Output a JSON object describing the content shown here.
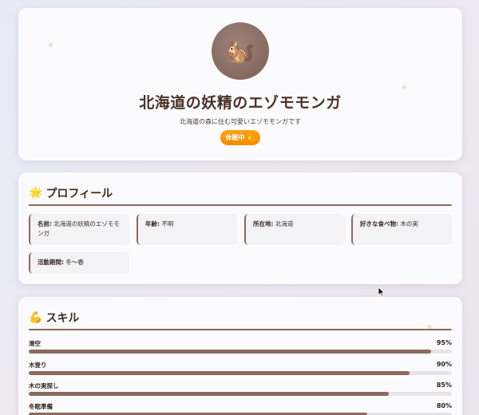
{
  "hero": {
    "avatar_emoji": "🐿️",
    "title": "北海道の妖精のエゾモモンガ",
    "subtitle": "北海道の森に住む可愛いエゾモモンガです",
    "status_label": "休眠中",
    "status_emoji": "💫",
    "status_color": "#f59200"
  },
  "profile": {
    "icon": "🌟",
    "title": "プロフィール",
    "items": [
      {
        "label": "名前:",
        "value": "北海道の妖精のエゾモモンガ"
      },
      {
        "label": "年齢:",
        "value": "不明"
      },
      {
        "label": "所在地:",
        "value": "北海道"
      },
      {
        "label": "好きな食べ物:",
        "value": "木の実"
      },
      {
        "label": "活動期間:",
        "value": "冬〜春"
      }
    ]
  },
  "skills": {
    "icon": "💪",
    "title": "スキル",
    "items": [
      {
        "name": "滑空",
        "percent_label": "95%",
        "level": 95
      },
      {
        "name": "木登り",
        "percent_label": "90%",
        "level": 90
      },
      {
        "name": "木の実探し",
        "percent_label": "85%",
        "level": 85
      },
      {
        "name": "冬眠準備",
        "percent_label": "80%",
        "level": 80
      }
    ]
  },
  "colors": {
    "accent_brown": "#8c6a5e",
    "badge_orange": "#f59200"
  }
}
